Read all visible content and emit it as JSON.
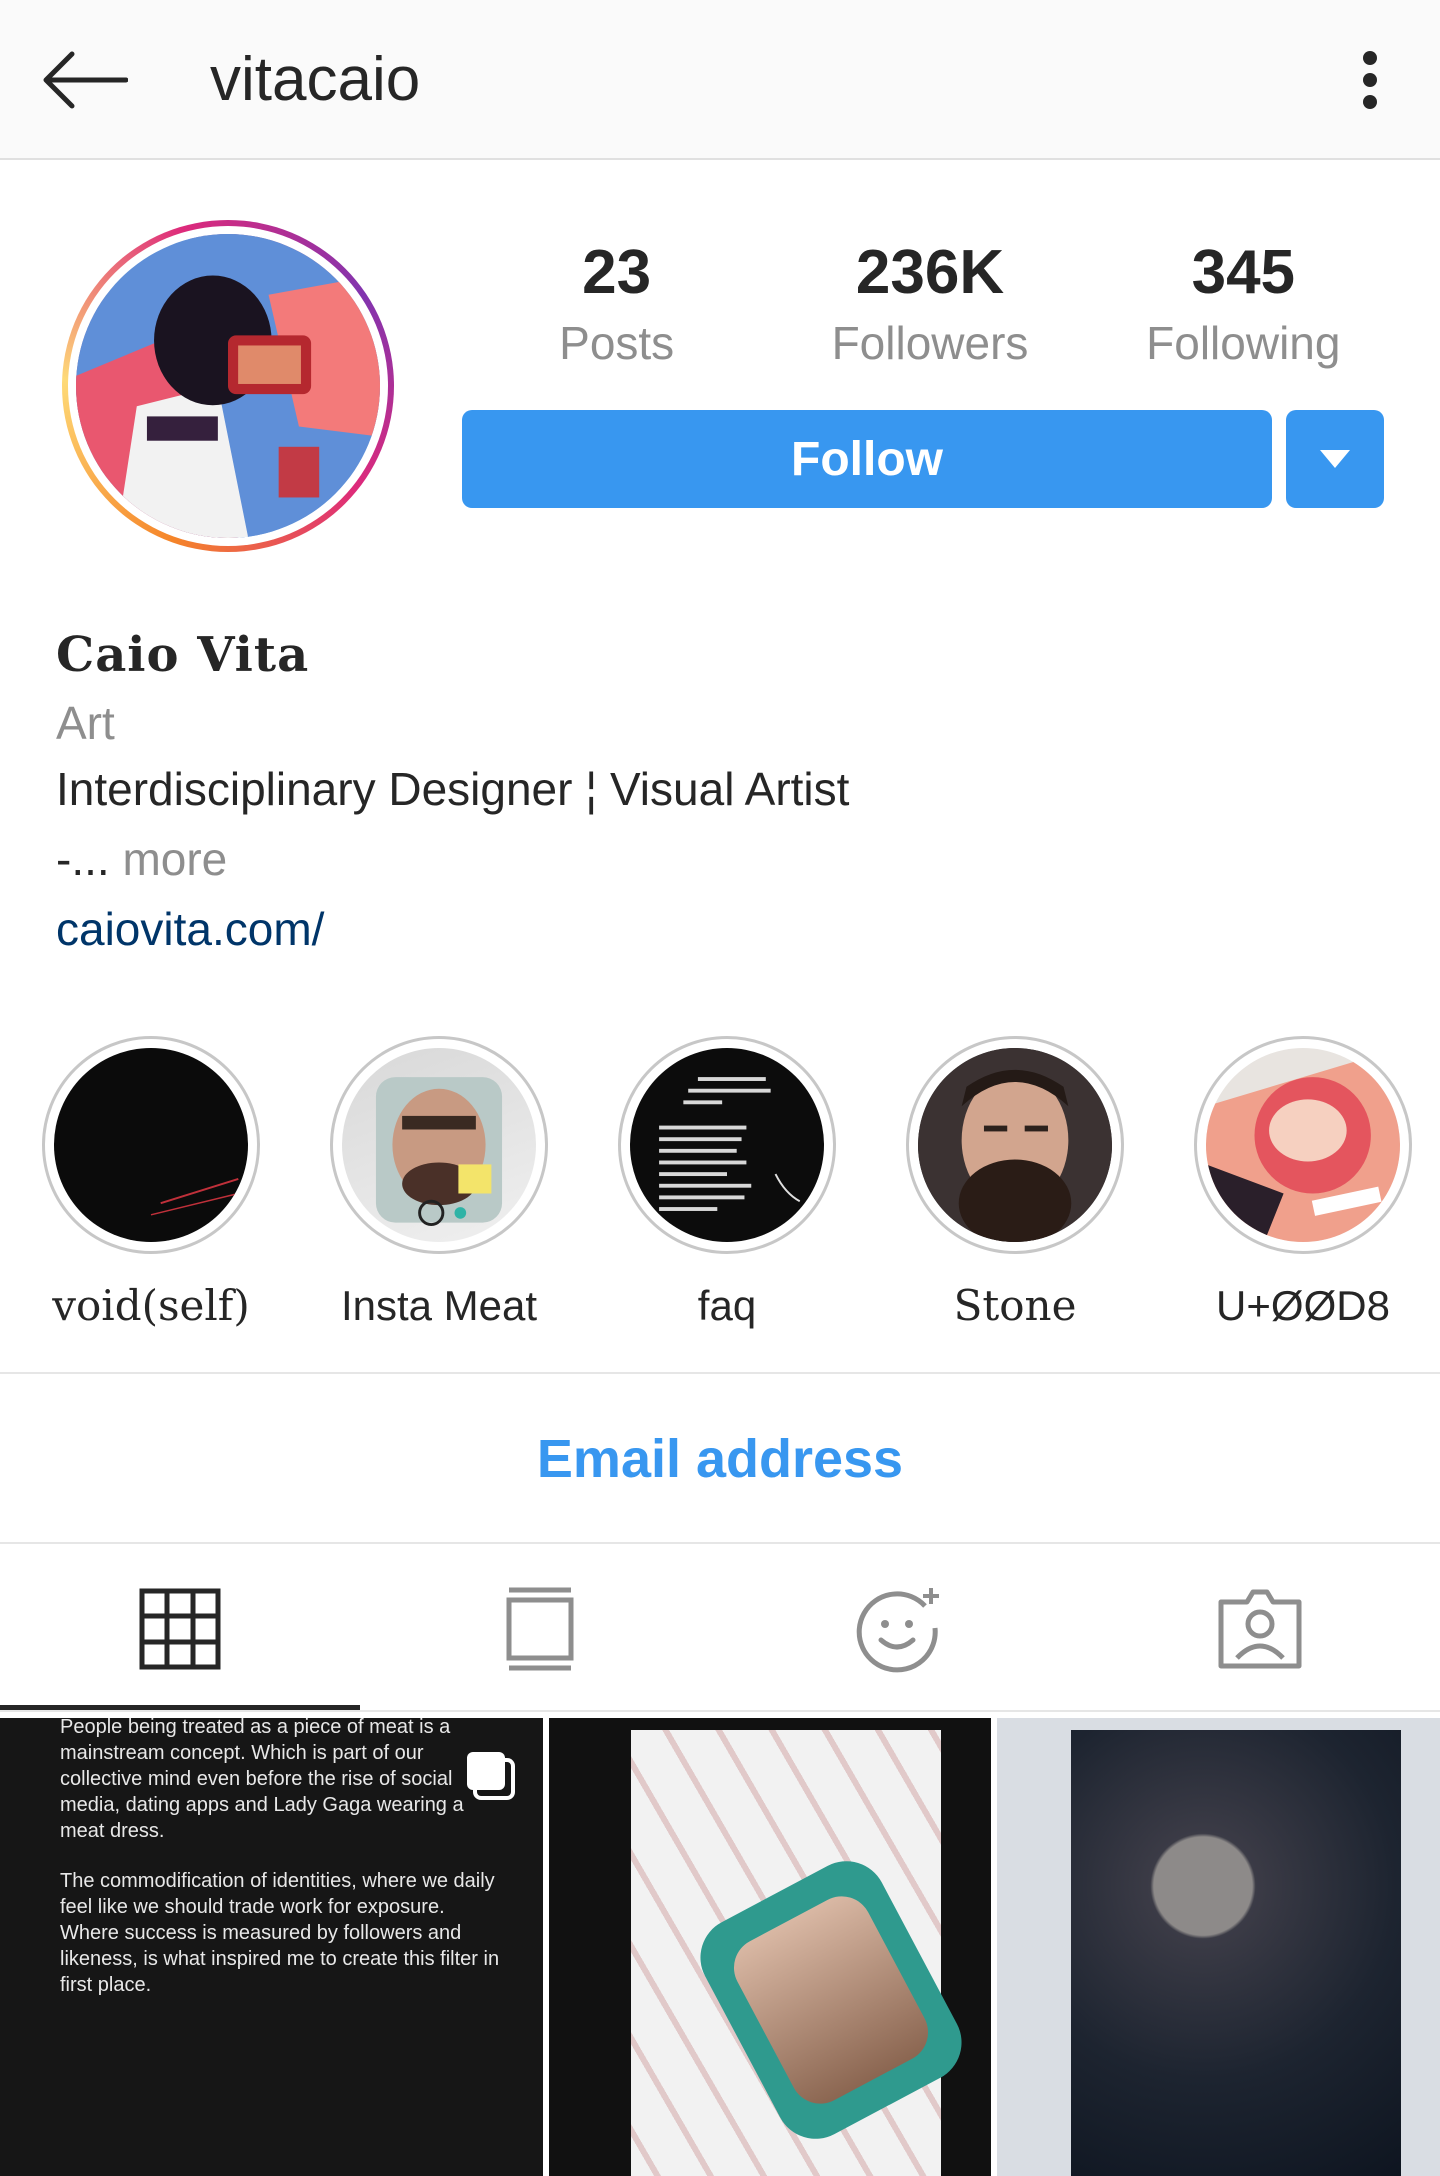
{
  "topbar": {
    "username": "vitacaio",
    "back_icon": "arrow-left-icon",
    "more_icon": "vertical-dots-icon"
  },
  "profile": {
    "stats": [
      {
        "value": "23",
        "label": "Posts"
      },
      {
        "value": "236K",
        "label": "Followers"
      },
      {
        "value": "345",
        "label": "Following"
      }
    ],
    "follow_label": "Follow",
    "full_name": "Caio Vita",
    "category": "Art",
    "bio": "Interdisciplinary Designer ¦ Visual Artist",
    "bio_truncated": "-...",
    "more_label": "more",
    "website": "caiovita.com/"
  },
  "highlights": [
    {
      "label": "void(self)"
    },
    {
      "label": "Insta Meat"
    },
    {
      "label": "faq"
    },
    {
      "label": "Stone"
    },
    {
      "label": "U+ØØD8"
    }
  ],
  "contact": {
    "email_label": "Email address"
  },
  "tabs": [
    {
      "icon": "grid-icon",
      "active": true
    },
    {
      "icon": "feed-icon",
      "active": false
    },
    {
      "icon": "effects-icon",
      "active": false
    },
    {
      "icon": "tagged-icon",
      "active": false
    }
  ],
  "posts": {
    "first_text_p1": "People being treated as a piece of meat is a mainstream concept. Which is part of our collective mind even before the rise of social media, dating apps and Lady Gaga wearing a meat dress.",
    "first_text_p2": "The commodification of identities, where we daily feel like we should trade work for exposure. Where success is measured by followers and likeness, is what inspired me to create this filter in first place."
  },
  "colors": {
    "accent": "#3897f0",
    "link": "#003569",
    "muted": "#8e8e8e",
    "text": "#262626"
  }
}
